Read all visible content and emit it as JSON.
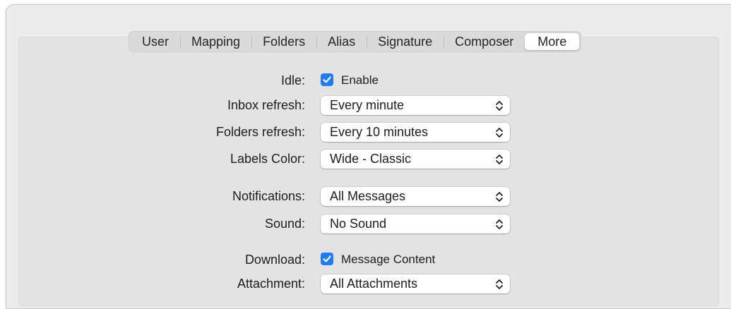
{
  "tabs": [
    "User",
    "Mapping",
    "Folders",
    "Alias",
    "Signature",
    "Composer",
    "More"
  ],
  "active_tab": "More",
  "form": {
    "idle": {
      "label": "Idle:",
      "checkbox_label": "Enable",
      "checked": true
    },
    "inbox_refresh": {
      "label": "Inbox refresh:",
      "value": "Every minute"
    },
    "folders_refresh": {
      "label": "Folders refresh:",
      "value": "Every 10 minutes"
    },
    "labels_color": {
      "label": "Labels Color:",
      "value": "Wide - Classic"
    },
    "notifications": {
      "label": "Notifications:",
      "value": "All Messages"
    },
    "sound": {
      "label": "Sound:",
      "value": "No Sound"
    },
    "download": {
      "label": "Download:",
      "checkbox_label": "Message Content",
      "checked": true
    },
    "attachment": {
      "label": "Attachment:",
      "value": "All Attachments"
    }
  },
  "colors": {
    "accent": "#1f7cf6",
    "window_bg": "#ececec",
    "panel_bg": "#e3e3e3"
  },
  "icons": {
    "select": "chevron-up-down-icon",
    "checkbox": "checkmark-icon"
  }
}
